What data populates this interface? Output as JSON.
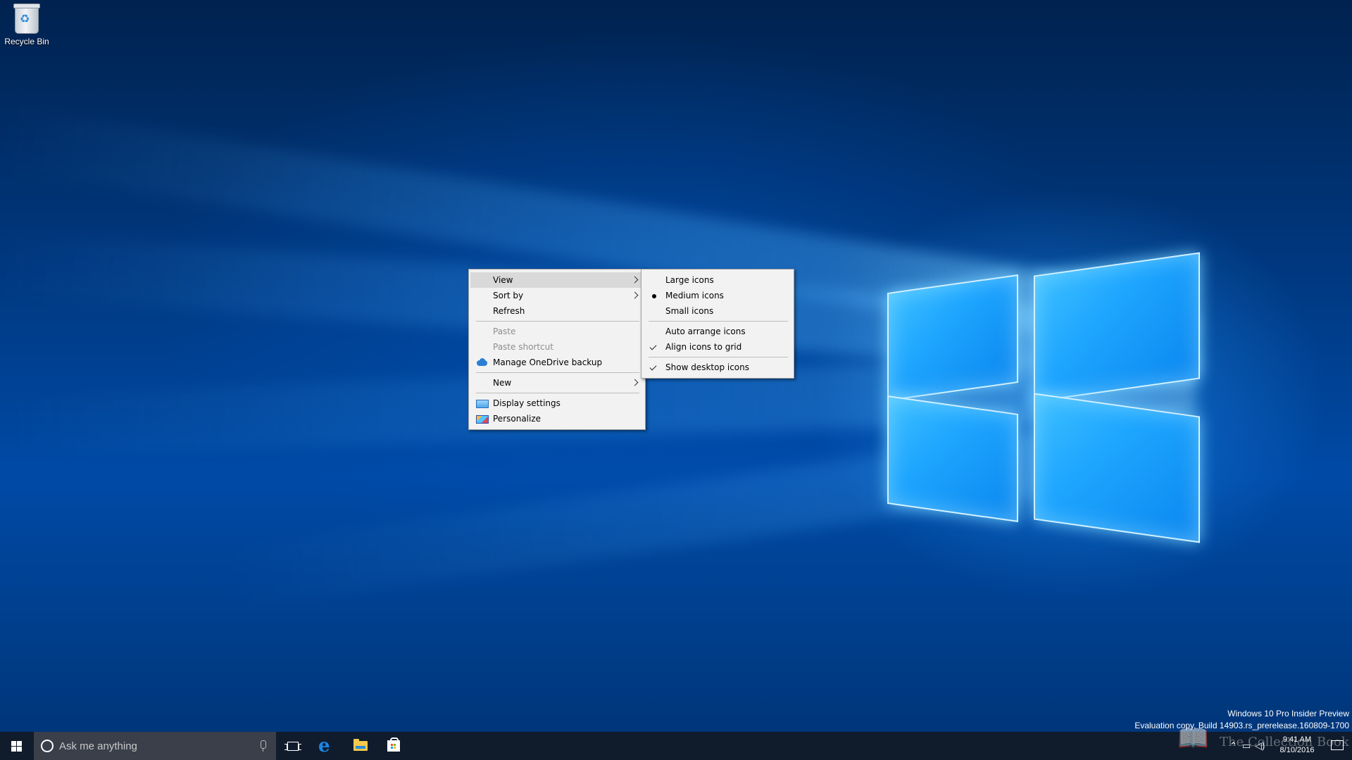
{
  "desktop": {
    "icons": [
      {
        "label": "Recycle Bin",
        "icon": "recycle-bin-icon"
      }
    ]
  },
  "context_menu": {
    "items": [
      {
        "label": "View",
        "has_submenu": true,
        "state": "highlighted"
      },
      {
        "label": "Sort by",
        "has_submenu": true
      },
      {
        "label": "Refresh"
      },
      {
        "label": "Paste",
        "disabled": true
      },
      {
        "label": "Paste shortcut",
        "disabled": true
      },
      {
        "label": "Manage OneDrive backup",
        "icon": "onedrive-icon"
      },
      {
        "label": "New",
        "has_submenu": true
      },
      {
        "label": "Display settings",
        "icon": "display-settings-icon"
      },
      {
        "label": "Personalize",
        "icon": "personalize-icon"
      }
    ]
  },
  "view_submenu": {
    "items": [
      {
        "label": "Large icons"
      },
      {
        "label": "Medium icons",
        "mark": "bullet"
      },
      {
        "label": "Small icons"
      },
      {
        "label": "Auto arrange icons"
      },
      {
        "label": "Align icons to grid",
        "mark": "check"
      },
      {
        "label": "Show desktop icons",
        "mark": "check"
      }
    ]
  },
  "watermark": {
    "line1": "Windows 10 Pro Insider Preview",
    "line2": "Evaluation copy. Build 14903.rs_prerelease.160809-1700"
  },
  "taskbar": {
    "search_placeholder": "Ask me anything",
    "pinned": [
      "task-view-icon",
      "edge-icon",
      "file-explorer-icon",
      "store-icon"
    ],
    "clock_time": "9:41 AM",
    "clock_date": "8/10/2016",
    "tray_icons": [
      "chevron-up-icon",
      "network-icon",
      "volume-icon",
      "action-center-icon"
    ]
  },
  "overlay_watermark": "The Collection Book",
  "colors": {
    "menu_bg": "#f2f2f2",
    "menu_highlight": "#d9d9d9",
    "taskbar_bg": "#101c2c",
    "search_bg": "#3a3f4a",
    "wallpaper_blue": "#004aa6"
  }
}
